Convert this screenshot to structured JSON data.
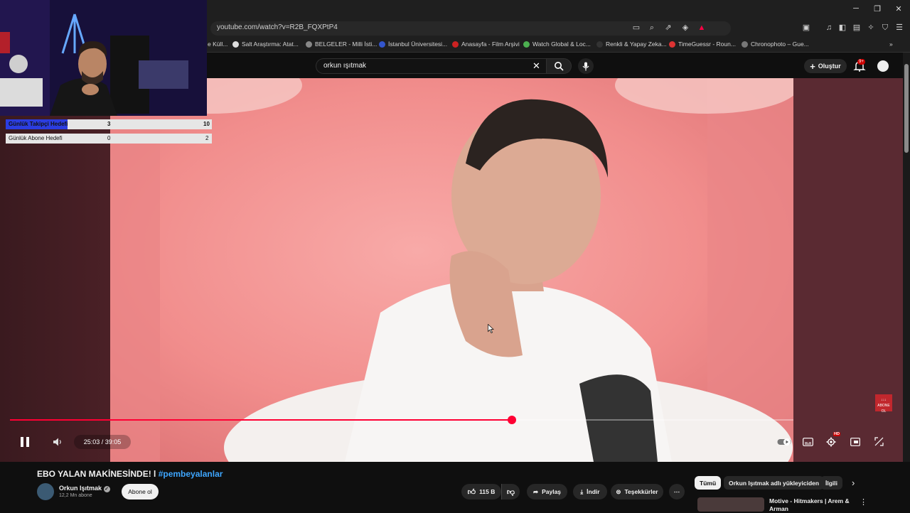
{
  "browser": {
    "url": "youtube.com/watch?v=R2B_FQXPtP4",
    "bookmarks": [
      "e Küll...",
      "Salt Araştırma: Atat...",
      "BELGELER - Milli İsti...",
      "İstanbul Üniversitesi...",
      "Anasayfa - Film Arşivi",
      "Watch Global & Loc...",
      "Renkli & Yapay Zeka...",
      "TimeGuessr - Roun...",
      "Chronophoto – Gue..."
    ]
  },
  "header": {
    "search_value": "orkun ışıtmak",
    "create_label": "Oluştur",
    "notification_badge": "9+"
  },
  "stream_overlay": {
    "goals": [
      {
        "label": "Günlük Takipçi Hedefi",
        "current": "3",
        "target": "10",
        "progress": 0.3
      },
      {
        "label": "Günlük Abone Hedefi",
        "current": "0",
        "target": "2",
        "progress": 0
      }
    ]
  },
  "player": {
    "time_display": "25:03 / 39:05",
    "progress": 0.641,
    "hd_badge": "HD",
    "watermark_text": "ABONE OL"
  },
  "video": {
    "title": "EBO YALAN MAKİNESİNDE! l",
    "hashtag": "#pembeyalanlar",
    "channel_name": "Orkun Işıtmak",
    "subscribers": "12,2 Mn abone",
    "subscribe_label": "Abone ol",
    "likes": "115 B",
    "share_label": "Paylaş",
    "download_label": "İndir",
    "thanks_label": "Teşekkürler"
  },
  "related_chips": [
    "Tümü",
    "Orkun Işıtmak adlı yükleyiciden",
    "İlgili"
  ],
  "recommendation": {
    "title": "Motive - Hitmakers | Arem & Arman"
  },
  "colors": {
    "accent": "#ff0033",
    "link": "#3ea6ff",
    "background": "#0f0f0f"
  }
}
